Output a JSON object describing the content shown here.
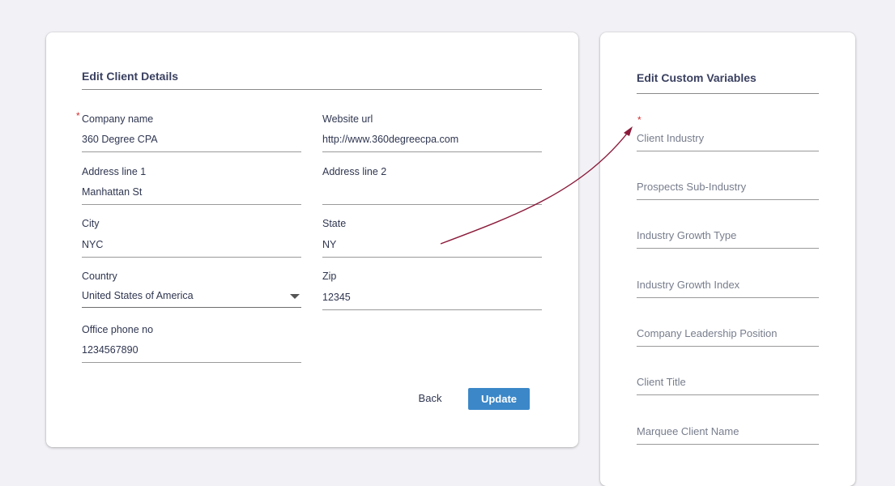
{
  "client_details": {
    "title": "Edit Client Details",
    "required_mark": "*",
    "fields": {
      "company_name": {
        "label": "Company name",
        "value": "360 Degree CPA",
        "required": true
      },
      "website_url": {
        "label": "Website url",
        "value": "http://www.360degreecpa.com"
      },
      "address_line_1": {
        "label": "Address line 1",
        "value": "Manhattan St"
      },
      "address_line_2": {
        "label": "Address line 2",
        "value": ""
      },
      "city": {
        "label": "City",
        "value": "NYC"
      },
      "state": {
        "label": "State",
        "value": "NY"
      },
      "country": {
        "label": "Country",
        "value": "United States of America"
      },
      "zip": {
        "label": "Zip",
        "value": "12345"
      },
      "office_phone": {
        "label": "Office phone no",
        "value": "1234567890"
      }
    },
    "back_label": "Back",
    "update_label": "Update"
  },
  "custom_variables": {
    "title": "Edit Custom Variables",
    "required_mark": "*",
    "fields": [
      {
        "placeholder": "Client Industry",
        "required": true
      },
      {
        "placeholder": "Prospects Sub-Industry"
      },
      {
        "placeholder": "Industry Growth Type"
      },
      {
        "placeholder": "Industry Growth Index"
      },
      {
        "placeholder": "Company Leadership Position"
      },
      {
        "placeholder": "Client Title"
      },
      {
        "placeholder": "Marquee Client Name"
      }
    ]
  },
  "colors": {
    "accent": "#3b87c8",
    "required": "#d32f2f",
    "annotation_arrow": "#8b1a3a"
  }
}
